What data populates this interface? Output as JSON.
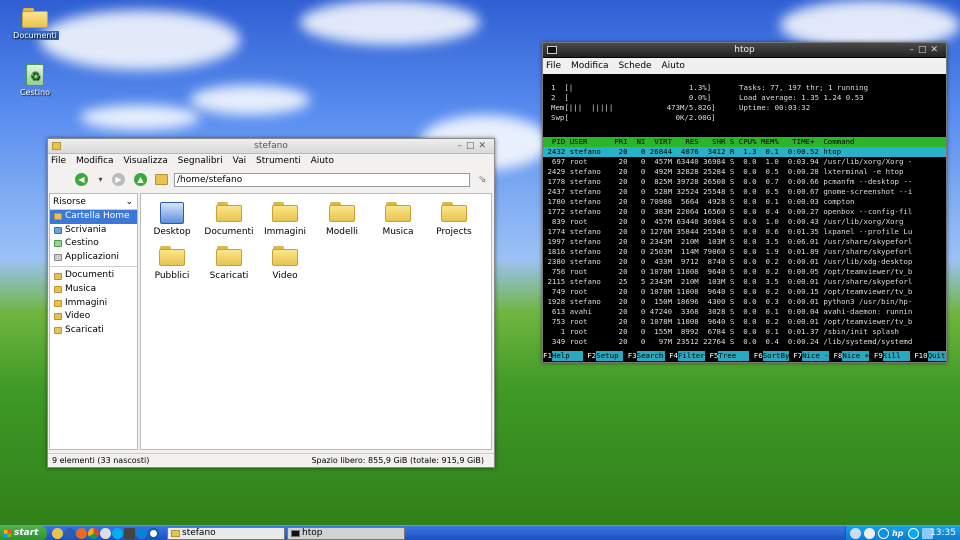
{
  "desktop": {
    "icons": [
      {
        "label": "Documenti"
      },
      {
        "label": "Cestino"
      }
    ]
  },
  "filemanager": {
    "title": "stefano",
    "menu": [
      "File",
      "Modifica",
      "Visualizza",
      "Segnalibri",
      "Vai",
      "Strumenti",
      "Aiuto"
    ],
    "path": "/home/stefano",
    "sidebar_header": "Risorse",
    "places": [
      "Cartella Home",
      "Scrivania",
      "Cestino",
      "Applicazioni"
    ],
    "bookmarks": [
      "Documenti",
      "Musica",
      "Immagini",
      "Video",
      "Scaricati"
    ],
    "files": [
      "Desktop",
      "Documenti",
      "Immagini",
      "Modelli",
      "Musica",
      "Projects",
      "Pubblici",
      "Scaricati",
      "Video"
    ],
    "status_left": "9 elementi (33 nascosti)",
    "status_right": "Spazio libero: 855,9 GiB (totale: 915,9 GiB)"
  },
  "htop": {
    "title": "htop",
    "menu": [
      "File",
      "Modifica",
      "Schede",
      "Aiuto"
    ],
    "cpu1": "1  [|                          1.3%]",
    "cpu2": "2  [                           0.0%]",
    "mem": "Mem[|||  |||||            473M/5.82G]",
    "swp": "Swp[                        0K/2.00G]",
    "tasks": "Tasks: 77, 197 thr; 1 running",
    "load": "Load average: 1.35 1.24 0.53",
    "uptime": "Uptime: 00:03:32",
    "header": "  PID USER      PRI  NI  VIRT   RES   SHR S CPU% MEM%   TIME+  Command",
    "rows": [
      " 2432 stefano    20   0 26844  4076  3412 R  1.3  0.1  0:00.52 htop",
      "  697 root       20   0  457M 63440 36984 S  0.0  1.0  0:03.94 /usr/lib/xorg/Xorg -",
      " 2429 stefano    20   0  492M 32828 25284 S  0.0  0.5  0:00.28 lxterminal -e htop",
      " 1778 stefano    20   0  825M 39728 26508 S  0.0  0.7  0:00.66 pcmanfm --desktop --",
      " 2437 stefano    20   0  528M 32524 25548 S  0.0  0.5  0:00.67 gnome-screenshot --i",
      " 1780 stefano    20   0 70988  5664  4928 S  0.0  0.1  0:00.03 compton",
      " 1772 stefano    20   0  383M 22064 16560 S  0.0  0.4  0:00.27 openbox --config-fil",
      "  839 root       20   0  457M 63440 36984 S  0.0  1.0  0:00.43 /usr/lib/xorg/Xorg",
      " 1774 stefano    20   0 1276M 35844 25540 S  0.0  0.6  0:01.35 lxpanel --profile Lu",
      " 1997 stefano    20   0 2343M  210M  103M S  0.0  3.5  0:06.01 /usr/share/skypeforl",
      " 1816 stefano    20   0 2503M  114M 79060 S  0.0  1.9  0:01.89 /usr/share/skypeforl",
      " 2380 stefano    20   0  433M  9712  8740 S  0.0  0.2  0:00.01 /usr/lib/xdg-desktop",
      "  756 root       20   0 1078M 11008  9640 S  0.0  0.2  0:00.05 /opt/teamviewer/tv_b",
      " 2115 stefano    25   5 2343M  210M  103M S  0.0  3.5  0:00.01 /usr/share/skypeforl",
      "  749 root       20   0 1078M 11008  9640 S  0.0  0.2  0:00.15 /opt/teamviewer/tv_b",
      " 1928 stefano    20   0  150M 18696  4300 S  0.0  0.3  0:00.01 python3 /usr/bin/hp-",
      "  613 avahi      20   0 47240  3368  3028 S  0.0  0.1  0:00.04 avahi-daemon: runnin",
      "  753 root       20   0 1078M 11008  9640 S  0.0  0.2  0:00.01 /opt/teamviewer/tv_b",
      "    1 root       20   0  155M  8992  6784 S  0.0  0.1  0:01.37 /sbin/init splash",
      "  349 root       20   0   97M 23512 22764 S  0.0  0.4  0:00.24 /lib/systemd/systemd"
    ],
    "fkeys": [
      {
        "key": "F1",
        "label": "Help"
      },
      {
        "key": "F2",
        "label": "Setup"
      },
      {
        "key": "F3",
        "label": "Search"
      },
      {
        "key": "F4",
        "label": "Filter"
      },
      {
        "key": "F5",
        "label": "Tree"
      },
      {
        "key": "F6",
        "label": "SortBy"
      },
      {
        "key": "F7",
        "label": "Nice -"
      },
      {
        "key": "F8",
        "label": "Nice +"
      },
      {
        "key": "F9",
        "label": "Kill"
      },
      {
        "key": "F10",
        "label": "Quit"
      }
    ]
  },
  "taskbar": {
    "start": "start",
    "tasks": [
      "stefano",
      "htop"
    ],
    "clock": "13:35"
  },
  "colors": {
    "htop_header": "#2bb52b",
    "htop_selected": "#28b2c9",
    "selection": "#3c78d8"
  }
}
